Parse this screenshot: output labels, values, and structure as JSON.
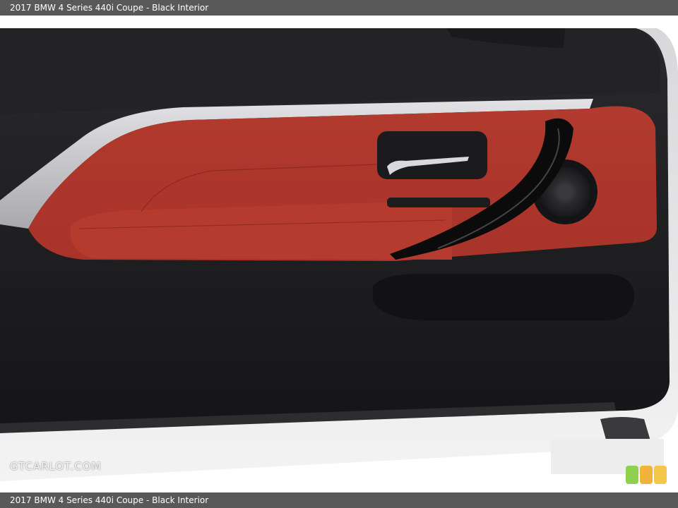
{
  "header": {
    "title": "2017 BMW 4 Series 440i Coupe - Black Interior"
  },
  "footer": {
    "caption": "2017 BMW 4 Series 440i Coupe - Black Interior"
  },
  "watermark": {
    "text": "GTCARLOT.COM"
  },
  "photo": {
    "subject": "door-panel",
    "colors": {
      "trim_black": "#1f1f21",
      "leather_red": "#b53a2d",
      "chrome": "#c9c9cc",
      "background": "#ffffff"
    },
    "icons": [
      "door-handle-icon",
      "speaker-icon",
      "window-switch-icon",
      "pull-handle-icon"
    ]
  },
  "badge": {
    "colors": [
      "#8fd14f",
      "#f0b43a",
      "#f2c74a"
    ]
  }
}
